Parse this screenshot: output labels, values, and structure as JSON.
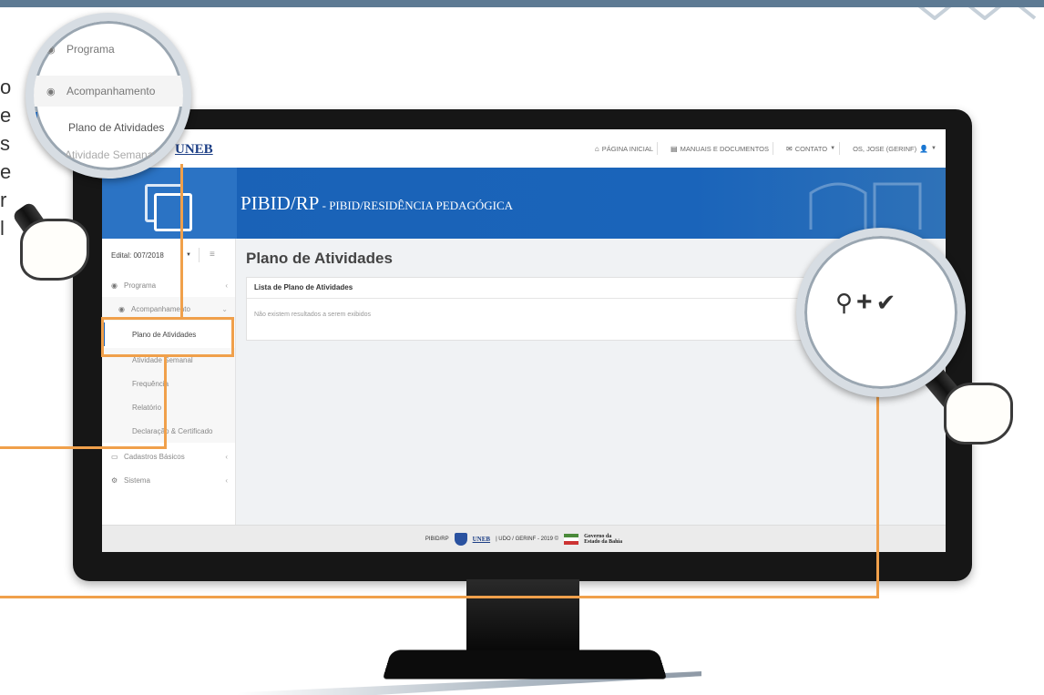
{
  "app": {
    "logo_text": "UNEB",
    "title": "PIBID/RP",
    "subtitle": " - PIBID/RESIDÊNCIA PEDAGÓGICA"
  },
  "topnav": {
    "home": "PÁGINA INICIAL",
    "manuals": "MANUAIS E DOCUMENTOS",
    "contact": "CONTATO",
    "user": "OS, JOSE (GERINF)"
  },
  "sidebar": {
    "edital": "Edital: 007/2018",
    "items": [
      {
        "label": "Programa",
        "icon": "eye-icon"
      },
      {
        "label": "Acompanhamento",
        "icon": "eye-icon"
      },
      {
        "label": "Plano de Atividades"
      },
      {
        "label": "Atividade Semanal"
      },
      {
        "label": "Frequência"
      },
      {
        "label": "Relatório"
      },
      {
        "label": "Declaração & Certificado"
      },
      {
        "label": "Cadastros Básicos",
        "icon": "drive-icon"
      },
      {
        "label": "Sistema",
        "icon": "gears-icon"
      }
    ]
  },
  "main": {
    "page_title": "Plano de Atividades",
    "panel_title": "Lista de Plano de Atividades",
    "empty_message": "Não existem resultados a serem exibidos"
  },
  "footer": {
    "left": "PIBID/RP",
    "logo": "UNEB",
    "text": "| UDO / GERINF - 2019 ©",
    "gov_line1": "Governo da",
    "gov_line2": "Estado da Bahia"
  },
  "magnifier_left": {
    "items": [
      "Programa",
      "Acompanhamento",
      "Plano de Atividades",
      "Atividade Semanal"
    ]
  },
  "magnifier_right": {
    "icons": [
      "search-icon",
      "plus-icon",
      "check-icon"
    ]
  },
  "colors": {
    "brand_blue": "#1a62b6",
    "highlight_orange": "#f0a04b"
  }
}
